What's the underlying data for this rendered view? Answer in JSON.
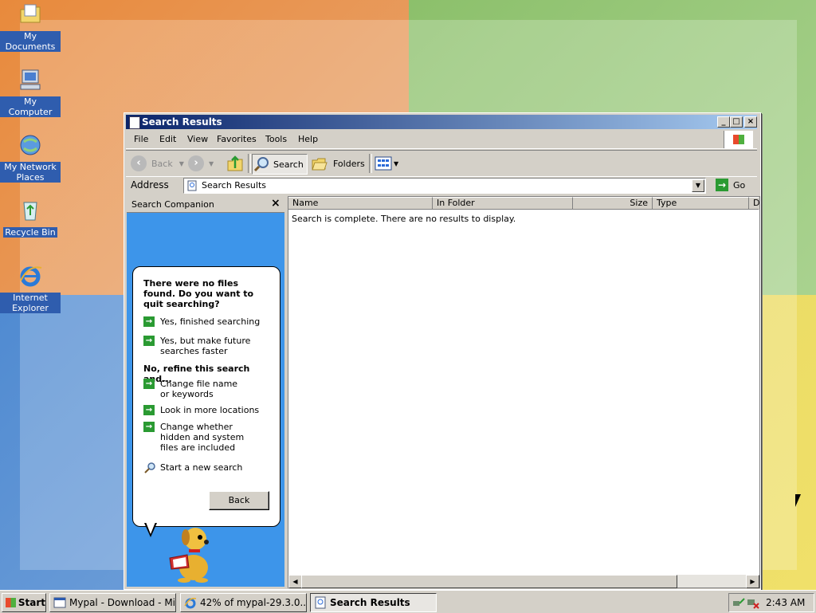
{
  "desktop": {
    "icons": [
      {
        "label": "My Documents",
        "icon": "folder-documents-icon"
      },
      {
        "label": "My Computer",
        "icon": "computer-icon"
      },
      {
        "label": "My Network Places",
        "icon": "network-places-icon"
      },
      {
        "label": "Recycle Bin",
        "icon": "recycle-bin-icon"
      },
      {
        "label": "Internet Explorer",
        "icon": "internet-explorer-icon"
      }
    ]
  },
  "window": {
    "title": "Search Results",
    "controls": {
      "minimize": "_",
      "maximize": "□",
      "close": "×"
    },
    "menu": [
      "File",
      "Edit",
      "View",
      "Favorites",
      "Tools",
      "Help"
    ],
    "toolbar": {
      "back": "Back",
      "search": "Search",
      "folders": "Folders"
    },
    "address": {
      "label": "Address",
      "value": "Search Results",
      "go": "Go"
    },
    "companion": {
      "title": "Search Companion",
      "close": "×",
      "question": "There were no files found. Do you want to quit searching?",
      "quit_options": [
        "Yes, finished searching",
        "Yes, but make future searches faster"
      ],
      "refine_heading": "No, refine this search and...",
      "refine_options": [
        "Change file name or keywords",
        "Look in more locations",
        "Change whether hidden and system files are included"
      ],
      "new_search": "Start a new search",
      "back_button": "Back"
    },
    "results": {
      "columns": [
        "Name",
        "In Folder",
        "Size",
        "Type",
        "D"
      ],
      "message": "Search is complete. There are no results to display."
    }
  },
  "taskbar": {
    "start": "Start",
    "tasks": [
      {
        "label": "Mypal - Download - Mi...",
        "active": false
      },
      {
        "label": "42% of mypal-29.3.0....",
        "active": false
      },
      {
        "label": "Search Results",
        "active": true
      }
    ],
    "clock": "2:43 AM"
  },
  "colors": {
    "title_start": "#0a246a",
    "title_end": "#a6caf0",
    "pane_blue": "#3d95ea",
    "arrow_green": "#2a9a32"
  }
}
